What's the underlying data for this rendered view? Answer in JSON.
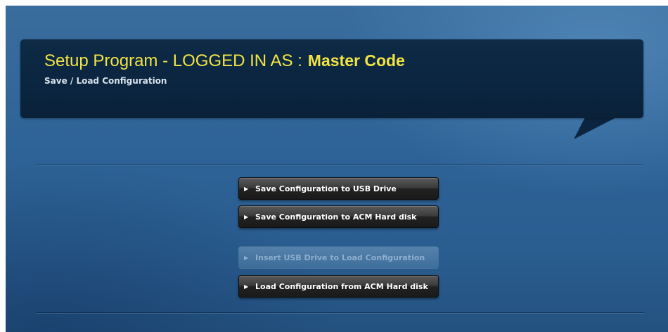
{
  "header": {
    "title_prefix": "Setup Program - LOGGED IN AS :",
    "user": "Master Code",
    "subtitle": "Save / Load Configuration"
  },
  "buttons": {
    "save_usb": "Save Configuration to USB Drive",
    "save_acm": "Save Configuration to ACM Hard disk",
    "insert_usb": "Insert USB Drive to Load Configuration",
    "load_acm": "Load Configuration from ACM Hard disk"
  },
  "icons": {
    "arrow": "▶"
  },
  "colors": {
    "title": "#f2e443",
    "header_bg": "#0e2a45",
    "background": "#2e6397",
    "button": "#2a2a2a"
  }
}
